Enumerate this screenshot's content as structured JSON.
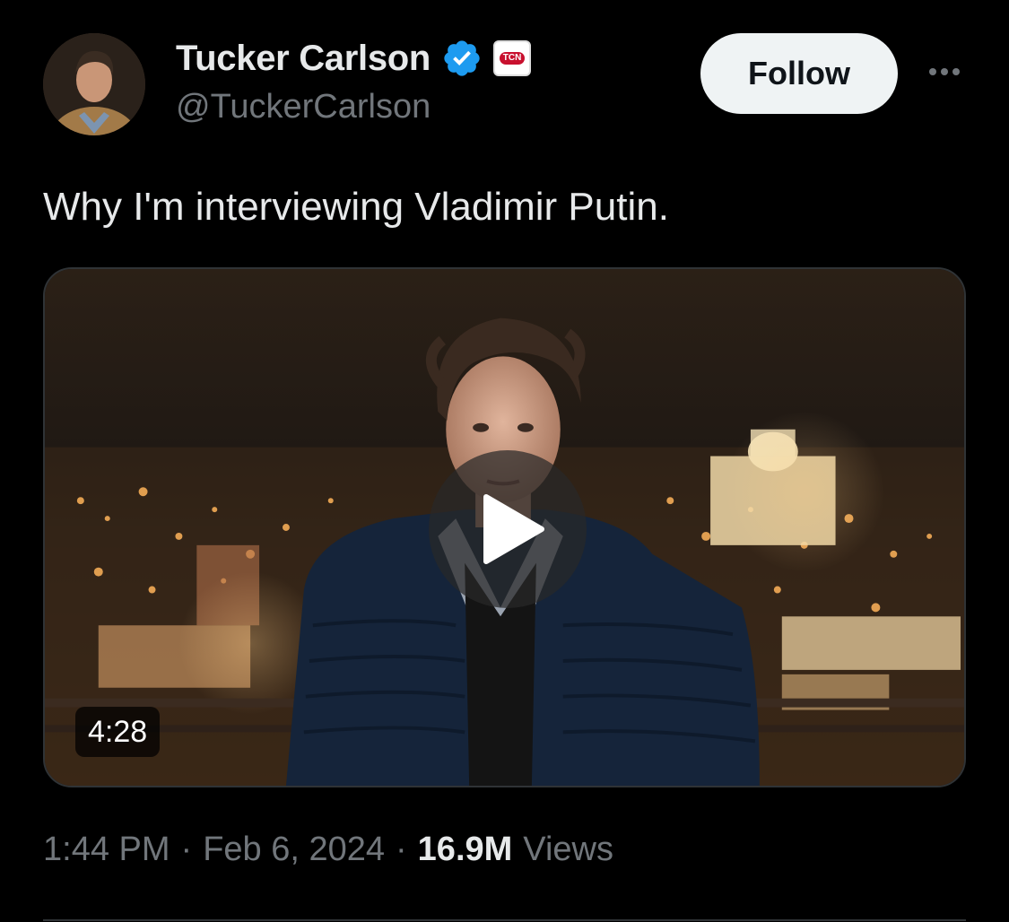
{
  "author": {
    "display_name": "Tucker Carlson",
    "handle": "@TuckerCarlson",
    "verified_icon": "verified-badge-icon",
    "affiliate_badge": "TCN",
    "verified_color": "#1d9bf0"
  },
  "actions": {
    "follow_label": "Follow",
    "more_icon": "more-horizontal-icon"
  },
  "post": {
    "text": "Why I'm interviewing Vladimir Putin.",
    "media": {
      "type": "video",
      "duration": "4:28",
      "play_icon": "play-icon"
    }
  },
  "meta": {
    "time": "1:44 PM",
    "separator": "·",
    "date": "Feb 6, 2024",
    "views_count": "16.9M",
    "views_label": "Views"
  },
  "colors": {
    "background": "#000000",
    "text_primary": "#e7e9ea",
    "text_secondary": "#71767b",
    "follow_button_bg": "#eff3f4"
  }
}
